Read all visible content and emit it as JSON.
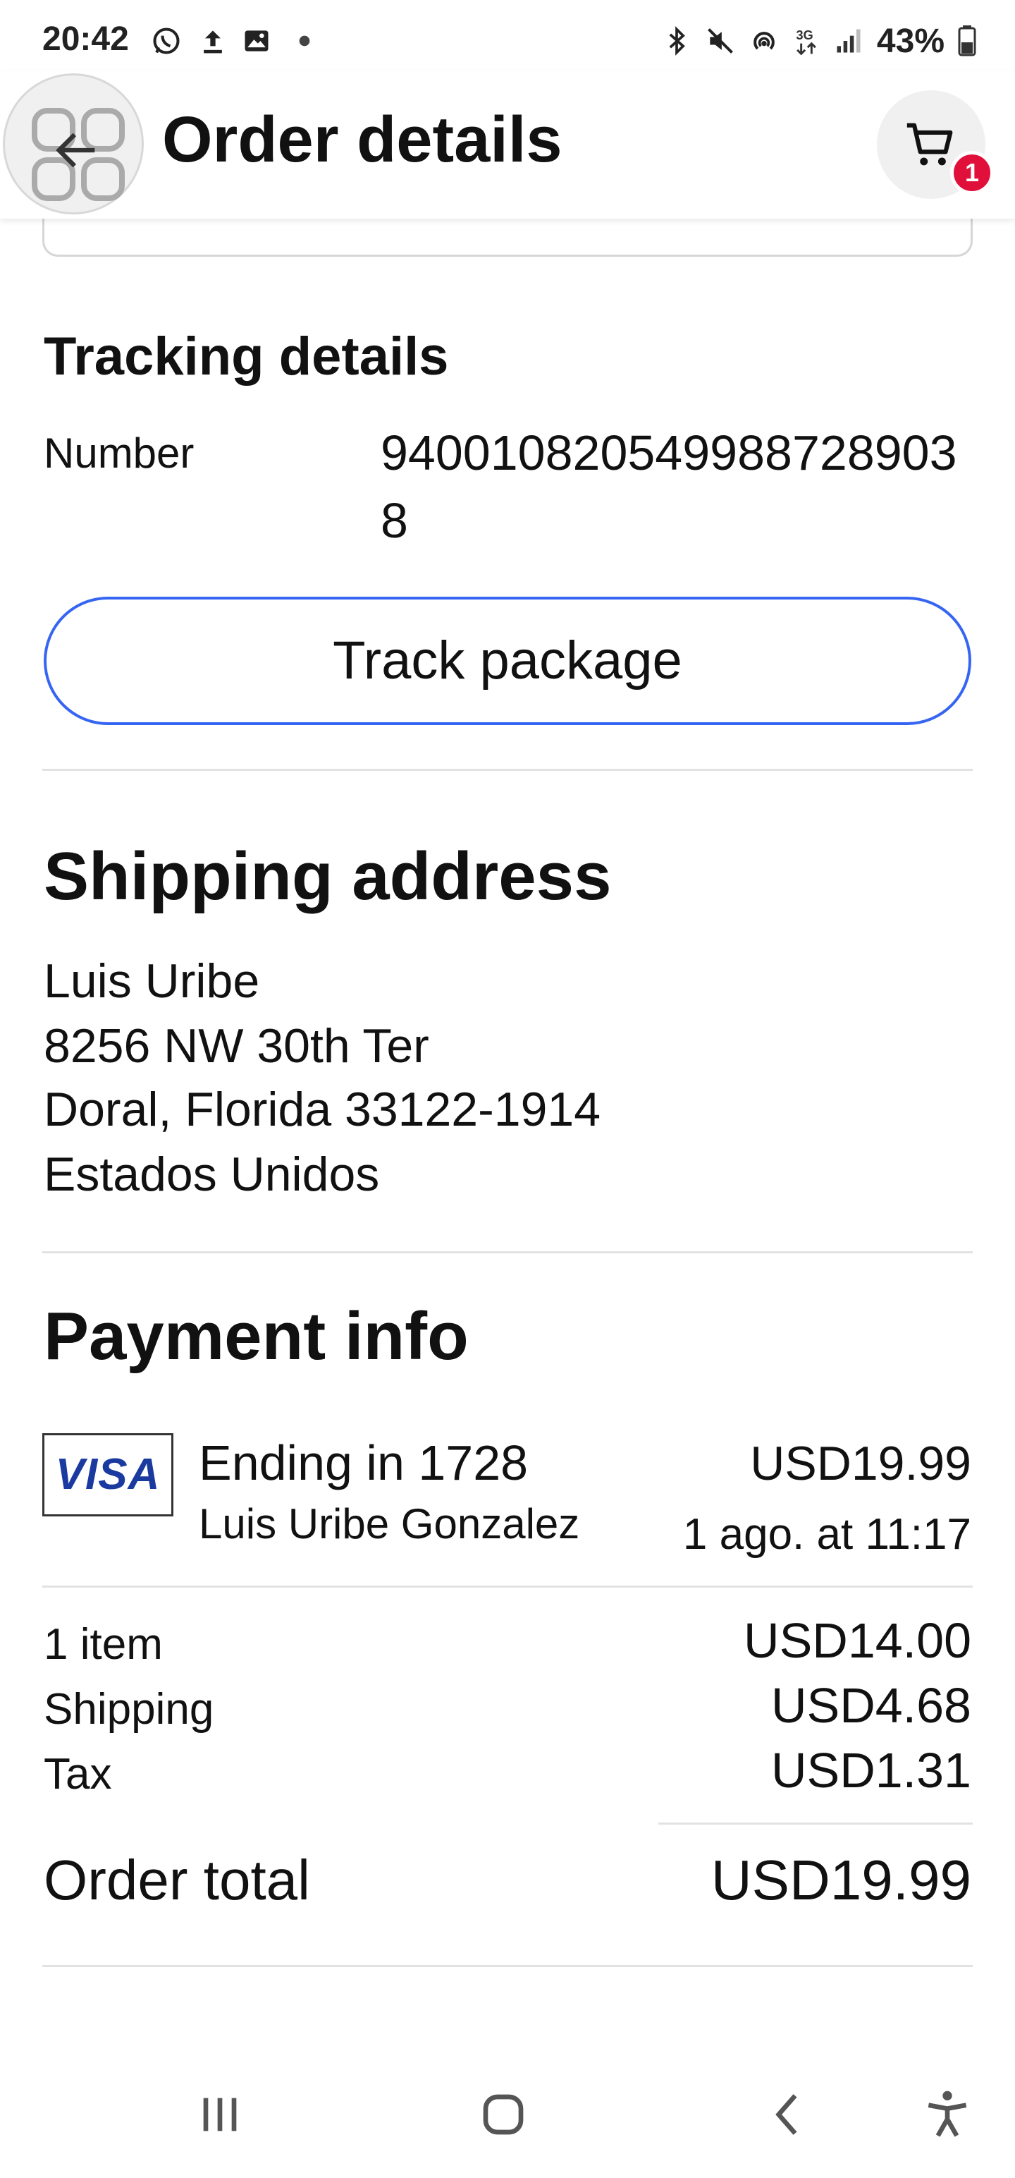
{
  "status_bar": {
    "time": "20:42",
    "battery": "43%",
    "left_icons": [
      "whatsapp-icon",
      "upload-icon",
      "gallery-icon",
      "dot-icon"
    ],
    "right_icons": [
      "bluetooth-icon",
      "mute-icon",
      "hotspot-icon",
      "network-3g-icon",
      "signal-icon",
      "battery-icon"
    ]
  },
  "header": {
    "title": "Order details",
    "cart_badge": "1",
    "badge_color": "#e0103a"
  },
  "tracking": {
    "heading": "Tracking details",
    "number_label": "Number",
    "number_value": "9400108205499887289038",
    "track_button": "Track package",
    "button_border_color": "#3665f3"
  },
  "shipping": {
    "heading": "Shipping address",
    "name": "Luis Uribe",
    "street": "8256 NW 30th Ter",
    "city_line": "Doral, Florida 33122-1914",
    "country": "Estados Unidos"
  },
  "payment": {
    "heading": "Payment info",
    "card_brand": "VISA",
    "card_ending": "Ending in 1728",
    "card_holder": "Luis  Uribe Gonzalez",
    "amount": "USD19.99",
    "date": "1 ago. at 11:17"
  },
  "summary": {
    "items_label": "1 item",
    "items_value": "USD14.00",
    "shipping_label": "Shipping",
    "shipping_value": "USD4.68",
    "tax_label": "Tax",
    "tax_value": "USD1.31",
    "total_label": "Order total",
    "total_value": "USD19.99"
  },
  "nav_bar": {
    "buttons": [
      "recent-apps-icon",
      "home-icon",
      "back-nav-icon",
      "accessibility-icon"
    ]
  }
}
